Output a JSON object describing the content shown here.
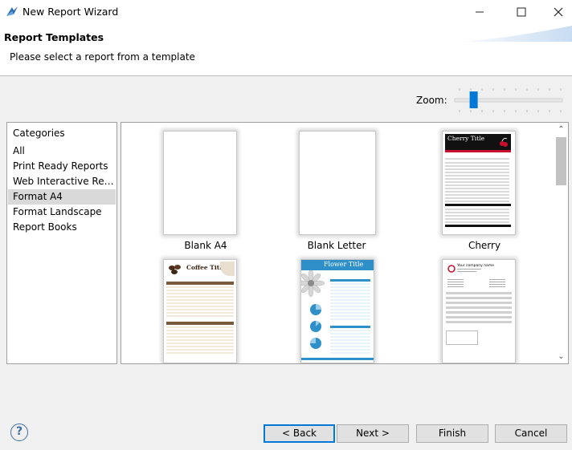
{
  "window": {
    "title": "New Report Wizard"
  },
  "header": {
    "title": "Report Templates",
    "description": "Please select a report from a template"
  },
  "zoom": {
    "label": "Zoom:",
    "level": 0.15
  },
  "categories": {
    "header": "Categories",
    "items": [
      {
        "label": "All"
      },
      {
        "label": "Print Ready Reports"
      },
      {
        "label": "Web Interactive Reports"
      },
      {
        "label": "Format A4",
        "selected": true
      },
      {
        "label": "Format Landscape"
      },
      {
        "label": "Report Books"
      }
    ]
  },
  "templates": {
    "items": [
      {
        "label": "Blank A4"
      },
      {
        "label": "Blank Letter"
      },
      {
        "label": "Cherry",
        "thumb_title": "Cherry Title"
      },
      {
        "label": "",
        "thumb_title": "Coffee Title"
      },
      {
        "label": "",
        "thumb_title": "Flower Title"
      },
      {
        "label": "",
        "thumb_title": "Your company name"
      }
    ]
  },
  "buttons": {
    "help": "?",
    "back": "< Back",
    "next": "Next >",
    "finish": "Finish",
    "cancel": "Cancel"
  },
  "colors": {
    "accent": "#0078d7",
    "selection": "#d9d9d9",
    "cherry": "#c8102e",
    "coffee": "#7a5a3c",
    "flower": "#2f8fc9"
  }
}
